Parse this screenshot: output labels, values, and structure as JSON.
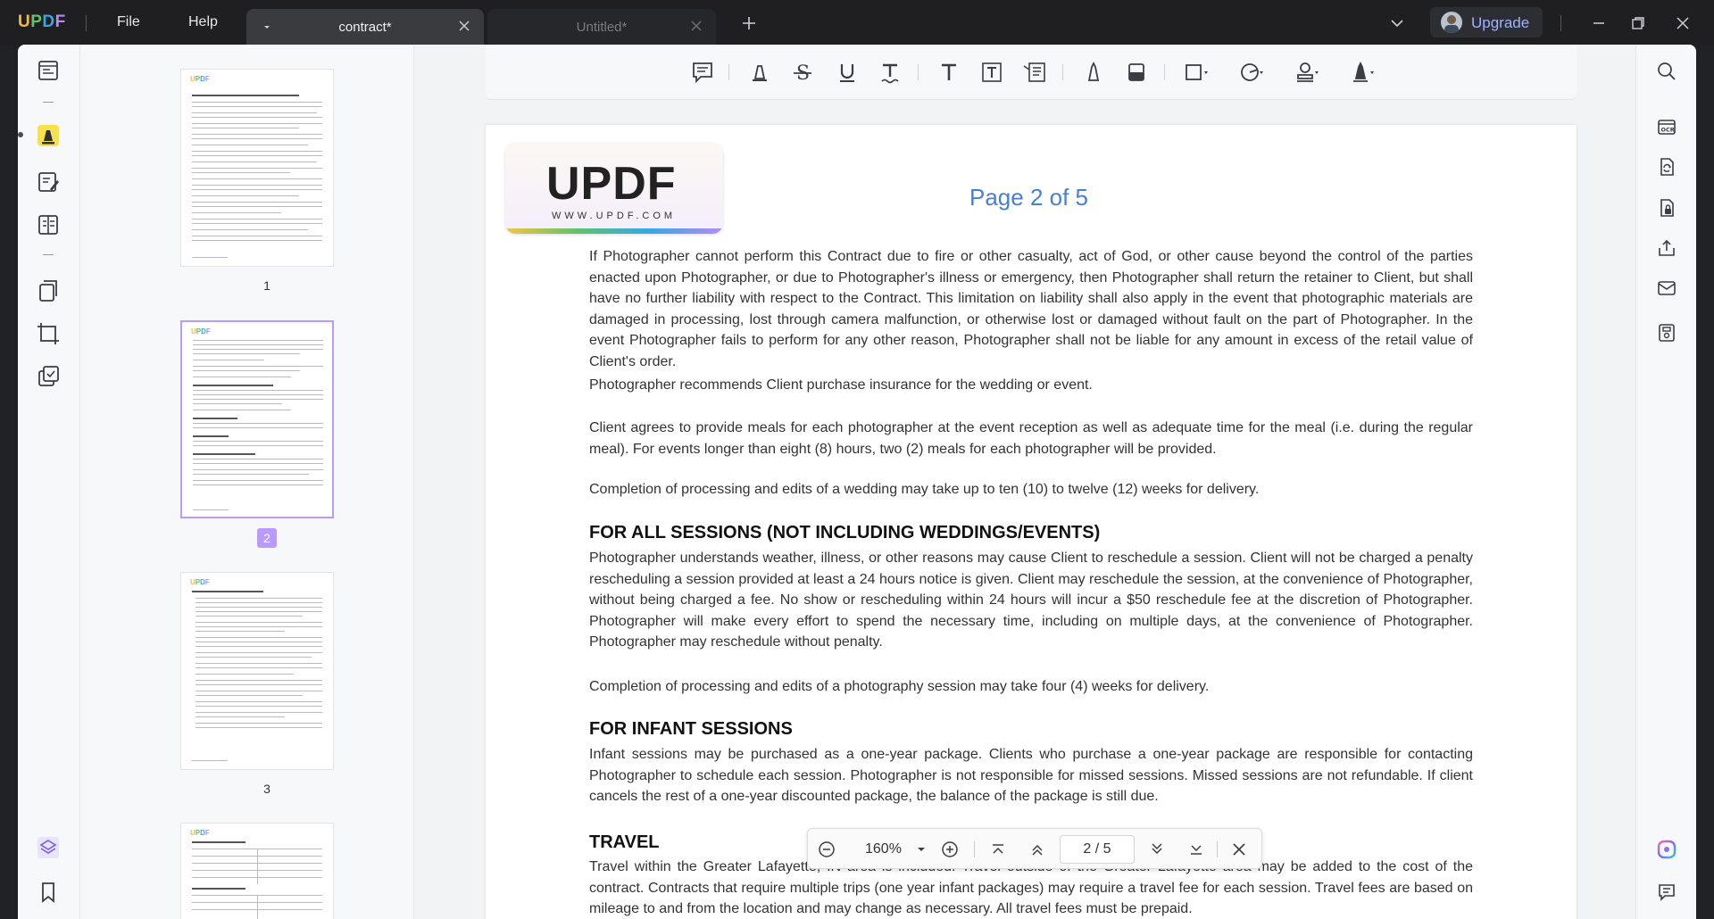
{
  "app": {
    "logo": "UPDF",
    "menu": {
      "file": "File",
      "help": "Help"
    },
    "tabs": [
      {
        "label": "contract*",
        "active": true
      },
      {
        "label": "Untitled*",
        "active": false
      }
    ],
    "upgrade_label": "Upgrade"
  },
  "thumbnails": [
    {
      "number": "1",
      "selected": false
    },
    {
      "number": "2",
      "selected": true
    },
    {
      "number": "3",
      "selected": false
    }
  ],
  "page": {
    "logo_text": "UPDF",
    "logo_sub": "WWW.UPDF.COM",
    "title": "Page 2 of 5",
    "para1": "If Photographer cannot perform this Contract due to fire or other casualty, act of God, or other cause beyond the control of the parties enacted upon Photographer, or due to Photographer's illness or emergency, then Photographer shall return the retainer to Client, but shall have no further liability with respect to the Contract. This limitation on liability shall also apply in the event that photographic materials are damaged in processing, lost through camera malfunction, or otherwise lost or damaged without fault on the part of Photographer. In the event Photographer fails to perform for any other reason, Photographer shall not be liable for any amount in excess of the retail value of Client's order.",
    "para2": "Photographer recommends Client purchase insurance for the wedding or event.",
    "para3": "Client agrees to provide meals for each photographer at the event reception as well as adequate time for the meal (i.e. during the regular meal). For events longer than eight (8) hours, two (2) meals for each photographer will be provided.",
    "para4": "Completion of processing and edits of a wedding may take up to ten (10) to twelve (12) weeks for delivery.",
    "heading1": "FOR ALL SESSIONS (NOT INCLUDING WEDDINGS/EVENTS)",
    "para5": "Photographer understands weather, illness, or other reasons may cause Client to reschedule a session. Client will not be charged a penalty rescheduling a session provided at least a 24 hours notice is given. Client may reschedule the session, at the convenience of Photographer, without being charged a fee. No show or rescheduling within 24 hours will incur a $50 reschedule fee at the discretion of Photographer. Photographer will make every effort to spend the necessary time, including on multiple days, at the convenience of Photographer. Photographer may reschedule without penalty.",
    "para6": "Completion of processing and edits of a photography session may take four (4) weeks for delivery.",
    "heading2": "FOR INFANT SESSIONS",
    "para7": "Infant sessions may be purchased as a one-year package. Clients who purchase a one-year package are responsible for contacting Photographer to schedule each session. Photographer is not responsible for missed sessions. Missed sessions are not refundable. If client cancels the rest of a one-year discounted package, the balance of the package is still due.",
    "heading3": "TRAVEL",
    "para8": "Travel within the Greater Lafayette, IN area is included. Travel outside of the Greater Lafayette area may be added to the cost of the contract. Contracts that require multiple trips (one year infant packages) may require a travel fee for each session. Travel fees are based on mileage to and from the location and may change as necessary. All travel fees must be prepaid."
  },
  "page_nav": {
    "zoom": "160%",
    "page_indicator": "2 / 5"
  },
  "colors": {
    "accent": "#b99aff",
    "title_blue": "#4a7fd0",
    "upgrade_text": "#9fb2ff"
  }
}
